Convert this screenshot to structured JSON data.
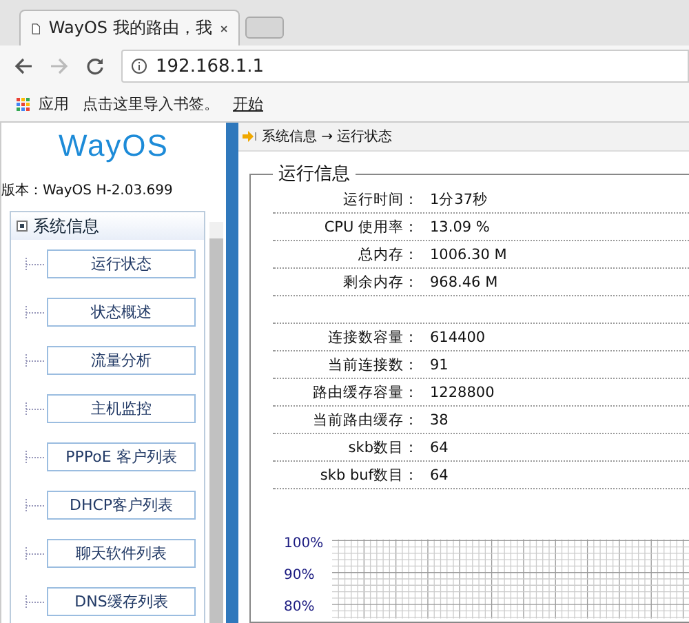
{
  "browser": {
    "tab_title": "WayOS 我的路由，我",
    "address": "192.168.1.1",
    "bookmarks": [
      {
        "label": "应用",
        "kind": "apps"
      },
      {
        "label": "点击这里导入书签。",
        "kind": "text"
      },
      {
        "label": "开始",
        "kind": "link"
      }
    ]
  },
  "sidebar": {
    "logo": "WayOS",
    "version": "版本：WayOS H-2.03.699",
    "menu_title": "系统信息",
    "items": [
      {
        "label": "运行状态",
        "selected": false
      },
      {
        "label": "状态概述",
        "selected": false
      },
      {
        "label": "流量分析",
        "selected": false
      },
      {
        "label": "主机监控",
        "selected": false
      },
      {
        "label": "PPPoE 客户列表",
        "selected": false
      },
      {
        "label": "DHCP客户列表",
        "selected": false
      },
      {
        "label": "聊天软件列表",
        "selected": false
      },
      {
        "label": "DNS缓存列表",
        "selected": false
      }
    ]
  },
  "breadcrumb": "系统信息 → 运行状态",
  "panel": {
    "title": "运行信息",
    "rows": [
      {
        "label": "运行时间：",
        "value": "1分37秒",
        "kind": "row"
      },
      {
        "label": "CPU 使用率：",
        "value": "13.09 %",
        "kind": "row"
      },
      {
        "label": "总内存：",
        "value": "1006.30 M",
        "kind": "row"
      },
      {
        "label": "剩余内存：",
        "value": "968.46 M",
        "kind": "row"
      },
      {
        "kind": "blank"
      },
      {
        "label": "连接数容量：",
        "value": "614400",
        "kind": "row"
      },
      {
        "label": "当前连接数：",
        "value": "91",
        "kind": "row"
      },
      {
        "label": "路由缓存容量：",
        "value": "1228800",
        "kind": "row"
      },
      {
        "label": "当前路由缓存：",
        "value": "38",
        "kind": "row"
      },
      {
        "label": "skb数目：",
        "value": "64",
        "kind": "row"
      },
      {
        "label": "skb buf数目：",
        "value": "64",
        "kind": "row"
      }
    ],
    "chart_ticks": [
      "100%",
      "90%",
      "80%"
    ]
  }
}
